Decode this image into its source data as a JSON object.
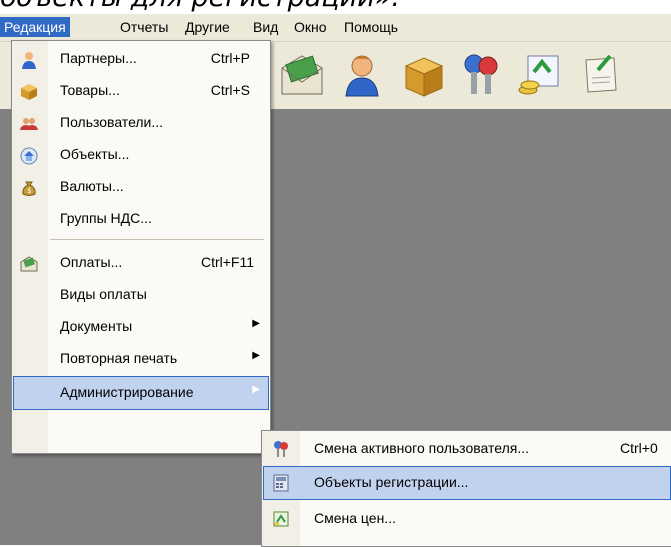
{
  "caption": "объекты для регистрации».",
  "menubar": {
    "items": [
      "Редакция",
      "Отчеты",
      "Другие",
      "Вид",
      "Окно",
      "Помощь"
    ]
  },
  "toolbar": {
    "icons": [
      "money-envelope-icon",
      "user-icon",
      "box-icon",
      "keys-icon",
      "coins-icon",
      "scroll-icon"
    ]
  },
  "menu": {
    "items": [
      {
        "label": "Партнеры...",
        "shortcut": "Ctrl+P",
        "icon": "partner-icon"
      },
      {
        "label": "Товары...",
        "shortcut": "Ctrl+S",
        "icon": "box-icon"
      },
      {
        "label": "Пользователи...",
        "shortcut": "",
        "icon": "users-icon"
      },
      {
        "label": "Объекты...",
        "shortcut": "",
        "icon": "house-icon"
      },
      {
        "label": "Валюты...",
        "shortcut": "",
        "icon": "money-bag-icon"
      },
      {
        "label": "Группы НДС...",
        "shortcut": "",
        "icon": ""
      },
      {
        "label": "Оплаты...",
        "shortcut": "Ctrl+F11",
        "icon": "payment-icon"
      },
      {
        "label": "Виды оплаты",
        "shortcut": "",
        "icon": ""
      },
      {
        "label": "Документы",
        "shortcut": "",
        "icon": "",
        "submenu": true
      },
      {
        "label": "Повторная печать",
        "shortcut": "",
        "icon": "",
        "submenu": true
      },
      {
        "label": "Администрирование",
        "shortcut": "",
        "icon": "",
        "submenu": true
      }
    ]
  },
  "submenu": {
    "items": [
      {
        "label": "Смена активного пользователя...",
        "shortcut": "Ctrl+0",
        "icon": "keys-icon"
      },
      {
        "label": "Объекты регистрации...",
        "shortcut": "",
        "icon": "register-icon"
      },
      {
        "label": "Смена цен...",
        "shortcut": "",
        "icon": "price-change-icon"
      }
    ]
  }
}
